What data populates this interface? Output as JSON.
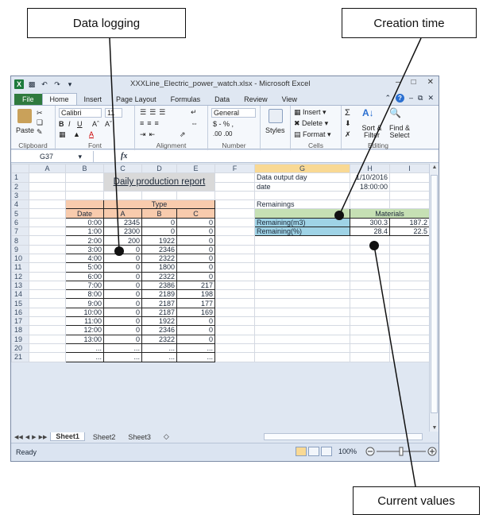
{
  "callouts": {
    "logging": "Data logging",
    "creation": "Creation time",
    "current": "Current values"
  },
  "window": {
    "title": "XXXLine_Electric_power_watch.xlsx - Microsoft Excel",
    "tabs": [
      "File",
      "Home",
      "Insert",
      "Page Layout",
      "Formulas",
      "Data",
      "Review",
      "View"
    ],
    "active_tab": "Home"
  },
  "ribbon": {
    "clipboard": {
      "label": "Clipboard",
      "paste": "Paste"
    },
    "font": {
      "label": "Font",
      "name": "Calibri",
      "size": "11"
    },
    "alignment": {
      "label": "Alignment"
    },
    "number": {
      "label": "Number",
      "format": "General",
      "currency": "$ - % ,",
      "decimals": ".00 .00"
    },
    "styles": {
      "label": "Styles"
    },
    "cells": {
      "label": "Cells",
      "insert": "Insert",
      "delete": "Delete",
      "format": "Format"
    },
    "editing": {
      "label": "Editing",
      "sort": "Sort & Filter",
      "find": "Find & Select"
    }
  },
  "formula_bar": {
    "name_box": "G37",
    "fx": "fx",
    "value": ""
  },
  "columns": [
    "A",
    "B",
    "C",
    "D",
    "E",
    "F",
    "G",
    "H",
    "I"
  ],
  "sheet": {
    "report_title": "Daily production  report",
    "data_output_day_label": "Data output day",
    "data_output_day": "1/10/2016",
    "date_label": "date",
    "time": "18:00:00",
    "remainings_label": "Remainings",
    "materials_label": "Materials",
    "remaining_m3_label": "Remaining(m3)",
    "remaining_m3": [
      "300.3",
      "187.2"
    ],
    "remaining_pct_label": "Remaining(%)",
    "remaining_pct": [
      "28.4",
      "22.5"
    ],
    "type_label": "Type",
    "date_header": "Date",
    "type_cols": [
      "A",
      "B",
      "C"
    ],
    "rows": [
      {
        "date": "0:00",
        "a": "2345",
        "b": "0",
        "c": "0"
      },
      {
        "date": "1:00",
        "a": "2300",
        "b": "0",
        "c": "0"
      },
      {
        "date": "2:00",
        "a": "200",
        "b": "1922",
        "c": "0"
      },
      {
        "date": "3:00",
        "a": "0",
        "b": "2346",
        "c": "0"
      },
      {
        "date": "4:00",
        "a": "0",
        "b": "2322",
        "c": "0"
      },
      {
        "date": "5:00",
        "a": "0",
        "b": "1800",
        "c": "0"
      },
      {
        "date": "6:00",
        "a": "0",
        "b": "2322",
        "c": "0"
      },
      {
        "date": "7:00",
        "a": "0",
        "b": "2386",
        "c": "217"
      },
      {
        "date": "8:00",
        "a": "0",
        "b": "2189",
        "c": "198"
      },
      {
        "date": "9:00",
        "a": "0",
        "b": "2187",
        "c": "177"
      },
      {
        "date": "10:00",
        "a": "0",
        "b": "2187",
        "c": "169"
      },
      {
        "date": "11:00",
        "a": "0",
        "b": "1922",
        "c": "0"
      },
      {
        "date": "12:00",
        "a": "0",
        "b": "2346",
        "c": "0"
      },
      {
        "date": "13:00",
        "a": "0",
        "b": "2322",
        "c": "0"
      },
      {
        "date": "...",
        "a": "...",
        "b": "...",
        "c": "..."
      },
      {
        "date": "...",
        "a": "...",
        "b": "...",
        "c": "..."
      }
    ]
  },
  "sheet_tabs": [
    "Sheet1",
    "Sheet2",
    "Sheet3"
  ],
  "active_sheet": "Sheet1",
  "status": {
    "ready": "Ready",
    "zoom": "100%"
  }
}
